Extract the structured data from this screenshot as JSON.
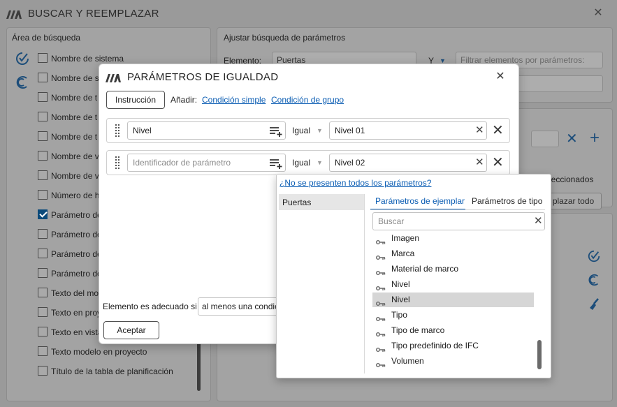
{
  "main_window": {
    "title": "BUSCAR Y REEMPLAZAR",
    "close_icon": "close-icon",
    "search_area": {
      "heading": "Área de búsqueda",
      "items": [
        {
          "label": "Nombre de sistema",
          "checked": false
        },
        {
          "label": "Nombre de s",
          "checked": false
        },
        {
          "label": "Nombre de t",
          "checked": false
        },
        {
          "label": "Nombre de t",
          "checked": false
        },
        {
          "label": "Nombre de t",
          "checked": false
        },
        {
          "label": "Nombre de v",
          "checked": false
        },
        {
          "label": "Nombre de v",
          "checked": false
        },
        {
          "label": "Número de h",
          "checked": false
        },
        {
          "label": "Parámetro de",
          "checked": true
        },
        {
          "label": "Parámetro de",
          "checked": false
        },
        {
          "label": "Parámetro de",
          "checked": false
        },
        {
          "label": "Parámetro de",
          "checked": false
        },
        {
          "label": "Texto del mo",
          "checked": false
        },
        {
          "label": "Texto en proy",
          "checked": false
        },
        {
          "label": "Texto en vista",
          "checked": false
        },
        {
          "label": "Texto modelo en proyecto",
          "checked": false
        },
        {
          "label": "Título de la tabla de planificación",
          "checked": false
        }
      ]
    },
    "param_search": {
      "heading": "Ajustar búsqueda de parámetros",
      "element_label": "Elemento:",
      "element_value": "Puertas",
      "logic_value": "Y",
      "filter_placeholder": "Filtrar elementos por parámetros:",
      "selected_text": "leccionados",
      "replace_all": "plazar todo"
    }
  },
  "dialog": {
    "title": "PARÁMETROS DE IGUALDAD",
    "instruction_button": "Instrucción",
    "add_label": "Añadir:",
    "simple_condition_link": "Condición simple",
    "group_condition_link": "Condición de grupo",
    "conditions": [
      {
        "parameter": "Nivel",
        "parameter_is_placeholder": false,
        "operator": "Igual",
        "value": "Nivel 01"
      },
      {
        "parameter": "Identificador de parámetro",
        "parameter_is_placeholder": true,
        "operator": "Igual",
        "value": "Nivel 02"
      }
    ],
    "match_label": "Elemento es adecuado si",
    "match_value": "al menos una condic",
    "accept_button": "Aceptar",
    "close_icon": "close-icon"
  },
  "param_popup": {
    "missing_params_link": "¿No se presenten todos los parámetros?",
    "categories": [
      "Puertas"
    ],
    "tabs": [
      "Parámetros de ejemplar",
      "Parámetros de tipo"
    ],
    "active_tab": "Parámetros de ejemplar",
    "search_placeholder": "Buscar",
    "params": [
      "Imagen",
      "Marca",
      "Material de marco",
      "Nivel",
      "Nivel",
      "Tipo",
      "Tipo de marco",
      "Tipo predefinido de IFC",
      "Volumen"
    ],
    "selected_index": 4
  },
  "colors": {
    "accent": "#0b5db3",
    "overlay": "#9a9a9a",
    "selected_row": "#d6d6d6",
    "check_blue": "#0b4a7a"
  }
}
